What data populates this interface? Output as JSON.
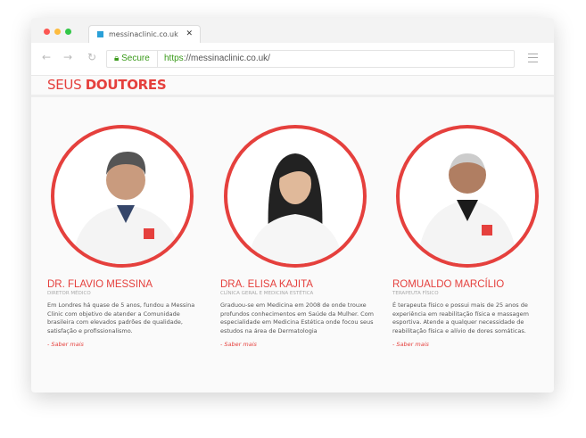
{
  "browser": {
    "tab_title": "messinaclinic.co.uk",
    "secure_label": "Secure",
    "url_scheme": "https",
    "url_rest": "://messinaclinic.co.uk/",
    "colors": {
      "close": "#fc5753",
      "minimize": "#fdbc40",
      "maximize": "#33c748"
    }
  },
  "section": {
    "title_light": "SEUS",
    "title_bold": "DOUTORES",
    "accent": "#e5403d"
  },
  "doctors": [
    {
      "name": "DR. FLAVIO MESSINA",
      "role": "DIRETOR MÉDICO",
      "description": "Em Londres há quase de 5 anos, fundou a Messina Clinic com objetivo de atender a Comunidade brasileira com elevados padrões de qualidade, satisfação e profissionalismo.",
      "link": "- Saber mais"
    },
    {
      "name": "DRA. ELISA KAJITA",
      "role": "CLÍNICA GERAL E MEDICINA ESTÉTICA",
      "description": "Graduou-se em Medicina em 2008 de onde trouxe profundos conhecimentos em Saúde da Mulher. Com especialidade em Medicina Estética onde focou seus estudos na área de Dermatologia",
      "link": "- Saber mais"
    },
    {
      "name": "ROMUALDO MARCÍLIO",
      "role": "TERAPEUTA FÍSICO",
      "description": "É terapeuta físico e possui mais de 25 anos de experiência em reabilitação física e massagem esportiva. Atende a qualquer necessidade de reabilitação física e alívio de dores somáticas.",
      "link": "- Saber mais"
    }
  ]
}
